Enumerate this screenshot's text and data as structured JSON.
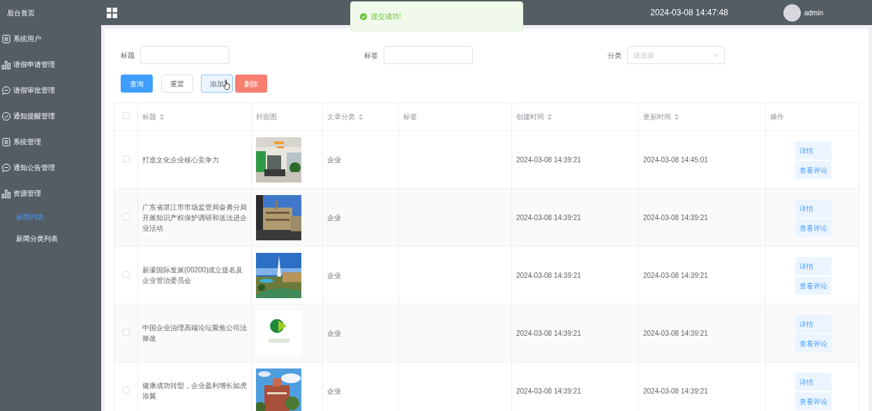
{
  "sidebar": {
    "items": [
      {
        "label": "后台首页"
      },
      {
        "label": "系统用户"
      },
      {
        "label": "请假申请管理"
      },
      {
        "label": "请假审批管理"
      },
      {
        "label": "通知提醒管理"
      },
      {
        "label": "系统管理"
      },
      {
        "label": "通知公告管理"
      },
      {
        "label": "资源管理",
        "children": [
          {
            "label": "新闻列表",
            "selected": true
          },
          {
            "label": "新闻分类列表",
            "selected": false
          }
        ]
      }
    ]
  },
  "header": {
    "datetime": "2024-03-08 14:47:48",
    "user": "admin"
  },
  "toast": {
    "message": "提交成功!"
  },
  "filters": [
    {
      "label": "标题",
      "kind": "input"
    },
    {
      "label": "标签",
      "kind": "input"
    },
    {
      "label": "分类",
      "kind": "select",
      "placeholder": "请选择"
    }
  ],
  "buttons": [
    {
      "label": "查询",
      "kind": "primary",
      "hovered": false
    },
    {
      "label": "重置",
      "kind": "plain",
      "hovered": false
    },
    {
      "label": "添加",
      "kind": "plain",
      "hovered": true
    },
    {
      "label": "删除",
      "kind": "danger",
      "hovered": false
    }
  ],
  "table": {
    "all_checked": false,
    "columns": [
      {
        "label": "标题",
        "sortable": true
      },
      {
        "label": "封面图",
        "sortable": false
      },
      {
        "label": "文章分类",
        "sortable": true
      },
      {
        "label": "标签",
        "sortable": false
      },
      {
        "label": "创建时间",
        "sortable": true
      },
      {
        "label": "更新时间",
        "sortable": true
      },
      {
        "label": "操作",
        "sortable": false
      }
    ],
    "rows": [
      {
        "checked": false,
        "title": "打造文化企业核心竞争力",
        "category": "企业",
        "created": "2024-03-08 14:39:21",
        "updated": "2024-03-08 14:45:01",
        "actions": [
          "详情",
          "查看评论"
        ]
      },
      {
        "checked": false,
        "title": "广东省湛江市市场监管局奋勇分局开展知识产权保护调研和送法进企业活动",
        "category": "企业",
        "created": "2024-03-08 14:39:21",
        "updated": "2024-03-08 14:39:21",
        "actions": [
          "详情",
          "查看评论"
        ]
      },
      {
        "checked": false,
        "title": "新濠国际发展(00200)成立提名及企业管治委员会",
        "category": "企业",
        "created": "2024-03-08 14:39:21",
        "updated": "2024-03-08 14:39:21",
        "actions": [
          "详情",
          "查看评论"
        ]
      },
      {
        "checked": false,
        "title": "中国企业治理高端论坛聚焦公司法修改",
        "category": "企业",
        "created": "2024-03-08 14:39:21",
        "updated": "2024-03-08 14:39:21",
        "actions": [
          "详情",
          "查看评论"
        ]
      },
      {
        "checked": false,
        "title": "健康成功转型，企业盈利增长如虎添翼",
        "category": "企业",
        "created": "2024-03-08 14:39:21",
        "updated": "2024-03-08 14:39:21",
        "actions": [
          "详情",
          "查看评论"
        ]
      }
    ]
  }
}
